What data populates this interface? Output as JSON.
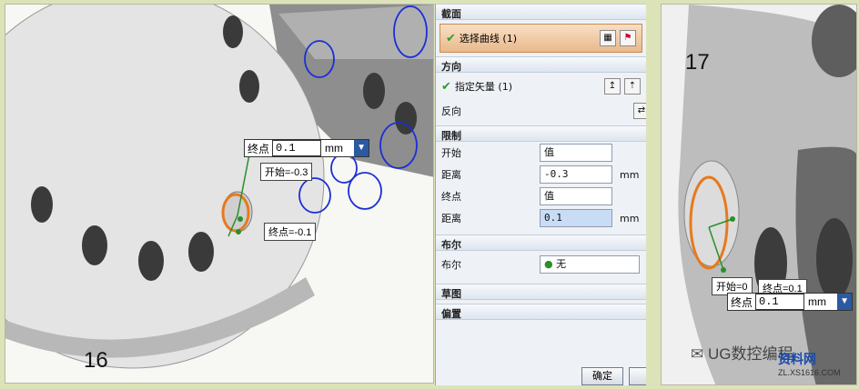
{
  "left_view": {
    "fig_number": "16",
    "end_field": {
      "label": "终点",
      "value": "0.1",
      "unit": "mm"
    },
    "start_callout": "开始=-0.3",
    "end_callout": "终点=-0.1"
  },
  "dialog": {
    "section_curve": "截面",
    "select_curve": "选择曲线 (1)",
    "section_direction": "方向",
    "specify_vector": "指定矢量 (1)",
    "reverse": "反向",
    "section_limits": "限制",
    "start_label": "开始",
    "start_value": "值",
    "distance1_label": "距离",
    "distance1_value": "-0.3",
    "distance1_unit": "mm",
    "end_label": "终点",
    "end_value": "值",
    "distance2_label": "距离",
    "distance2_value": "0.1",
    "distance2_unit": "mm",
    "section_boolean": "布尔",
    "boolean_label": "布尔",
    "boolean_value": "无",
    "section_sketch": "草图",
    "section_offset": "偏置",
    "ok_button": "确定"
  },
  "right_view": {
    "fig_number": "17",
    "start_callout": "开始=0",
    "end_callout": "终点=0.1",
    "end_field": {
      "label": "终点",
      "value": "0.1",
      "unit": "mm"
    },
    "watermark_text": "UG数控编程",
    "logo_text": "资料网",
    "logo_url": "ZL.XS1616.COM"
  },
  "colors": {
    "background": "#dde3b9",
    "selection_orange": "#e67a1e",
    "curve_blue": "#1a2fd6"
  }
}
